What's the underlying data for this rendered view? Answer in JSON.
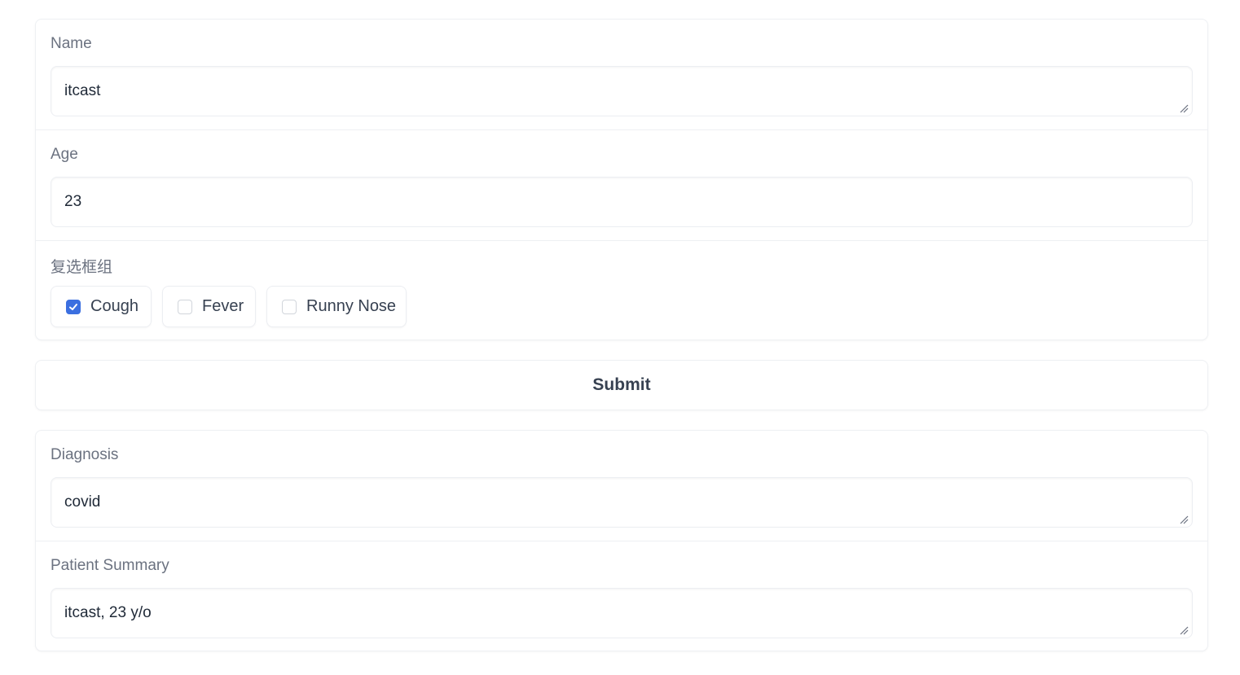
{
  "inputs": {
    "name": {
      "label": "Name",
      "value": "itcast"
    },
    "age": {
      "label": "Age",
      "value": "23"
    },
    "symptoms": {
      "label": "复选框组",
      "options": [
        {
          "label": "Cough",
          "checked": true
        },
        {
          "label": "Fever",
          "checked": false
        },
        {
          "label": "Runny Nose",
          "checked": false
        }
      ]
    }
  },
  "submit_label": "Submit",
  "outputs": {
    "diagnosis": {
      "label": "Diagnosis",
      "value": "covid"
    },
    "summary": {
      "label": "Patient Summary",
      "value": "itcast, 23 y/o"
    }
  },
  "colors": {
    "accent": "#3b6fe0",
    "label_text": "#6b7280",
    "border": "#eef0f3"
  },
  "icons": {
    "resize_handle": "resize-handle-icon",
    "checkmark": "checkmark-icon"
  }
}
